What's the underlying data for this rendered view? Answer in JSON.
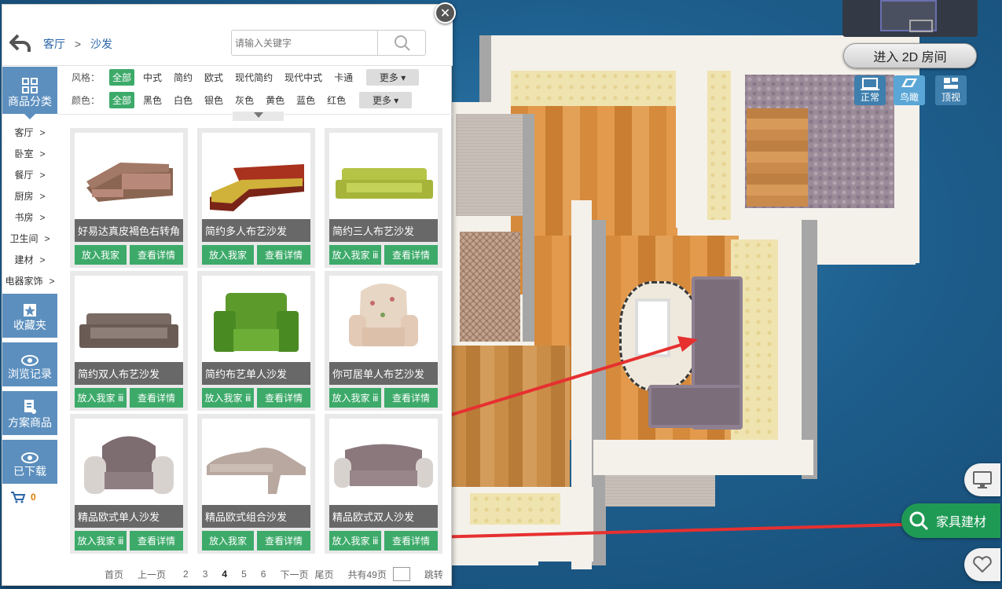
{
  "view": {
    "enter_2d_label": "进入 2D 房间",
    "mode_normal": "正常",
    "mode_bird": "鸟瞰",
    "mode_top": "顶视"
  },
  "header": {
    "breadcrumb_root": "客厅",
    "breadcrumb_sep": ">",
    "breadcrumb_leaf": "沙发",
    "search_placeholder": "请输入关键字"
  },
  "sidebar": {
    "category_title": "商品分类",
    "categories": [
      {
        "label": "客厅",
        "arrow": ">"
      },
      {
        "label": "卧室",
        "arrow": ">"
      },
      {
        "label": "餐厅",
        "arrow": ">"
      },
      {
        "label": "厨房",
        "arrow": ">"
      },
      {
        "label": "书房",
        "arrow": ">"
      },
      {
        "label": "卫生间",
        "arrow": ">"
      },
      {
        "label": "建材",
        "arrow": ">"
      },
      {
        "label": "电器家饰",
        "arrow": ">"
      }
    ],
    "favorites": "收藏夹",
    "history": "浏览记录",
    "plan_goods": "方案商品",
    "downloaded": "已下载",
    "cart_count": "0"
  },
  "filters": {
    "style_label": "风格：",
    "style_options": [
      "全部",
      "中式",
      "简约",
      "欧式",
      "现代简约",
      "现代中式",
      "卡通"
    ],
    "color_label": "颜色：",
    "color_options": [
      "全部",
      "黑色",
      "白色",
      "银色",
      "灰色",
      "黄色",
      "蓝色",
      "红色"
    ],
    "more": "更多"
  },
  "products": [
    {
      "name": "好易达真皮褐色右转角",
      "add": "放入我家",
      "detail": "查看详情"
    },
    {
      "name": "简约多人布艺沙发",
      "add": "放入我家",
      "detail": "查看详情"
    },
    {
      "name": "简约三人布艺沙发",
      "add": "放入我家 ⅲ",
      "detail": "查看详情"
    },
    {
      "name": "简约双人布艺沙发",
      "add": "放入我家 ⅲ",
      "detail": "查看详情"
    },
    {
      "name": "简约布艺单人沙发",
      "add": "放入我家 ⅲ",
      "detail": "查看详情"
    },
    {
      "name": "你可居单人布艺沙发",
      "add": "放入我家 ⅲ",
      "detail": "查看详情"
    },
    {
      "name": "精品欧式单人沙发",
      "add": "放入我家 ⅲ",
      "detail": "查看详情"
    },
    {
      "name": "精品欧式组合沙发",
      "add": "放入我家",
      "detail": "查看详情"
    },
    {
      "name": "精品欧式双人沙发",
      "add": "放入我家 ⅲ",
      "detail": "查看详情"
    }
  ],
  "pager": {
    "first": "首页",
    "prev": "上一页",
    "pages": [
      "2",
      "3",
      "4",
      "5",
      "6"
    ],
    "current": "4",
    "next": "下一页",
    "last": "尾页",
    "total": "共有49页",
    "jump": "跳转"
  },
  "fab": {
    "furniture": "家具建材"
  }
}
